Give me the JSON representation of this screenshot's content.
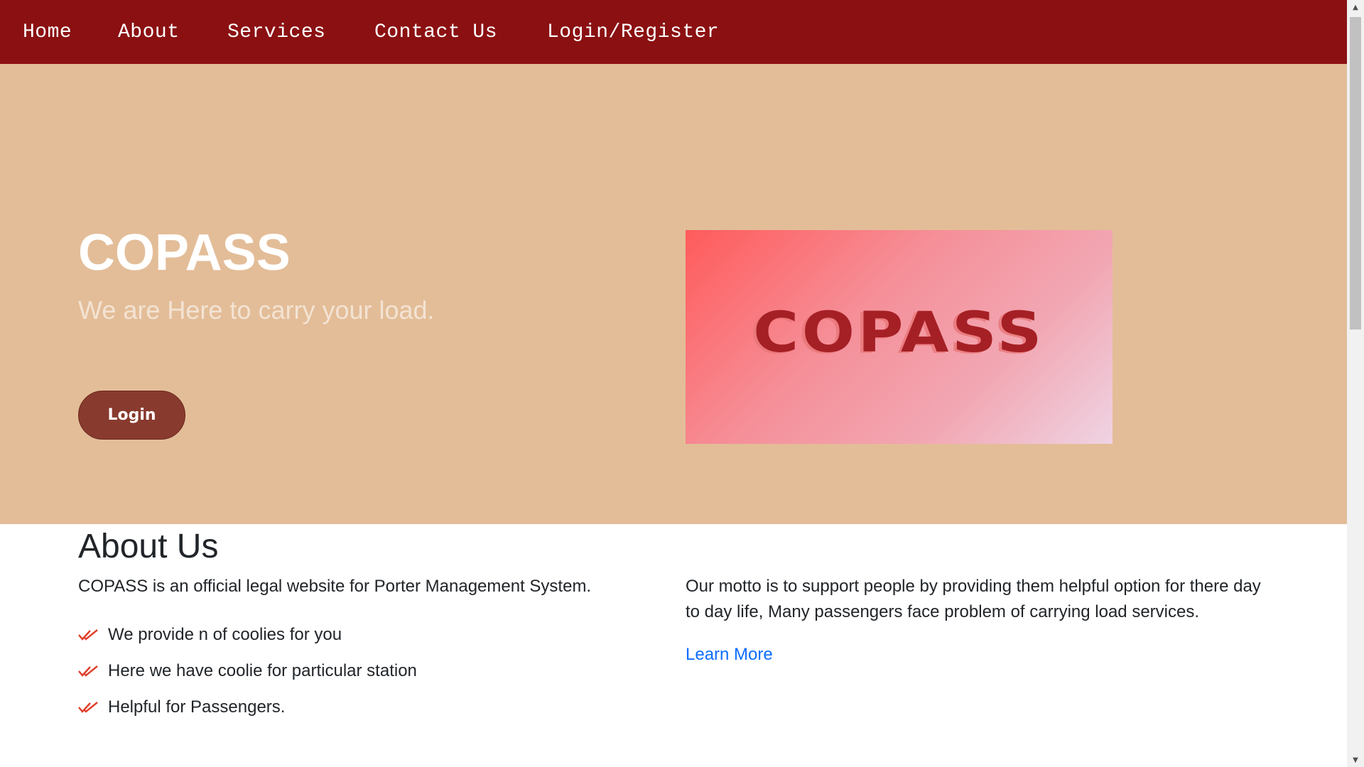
{
  "nav": {
    "items": [
      {
        "label": "Home"
      },
      {
        "label": "About"
      },
      {
        "label": "Services"
      },
      {
        "label": "Contact Us"
      },
      {
        "label": "Login/Register"
      }
    ]
  },
  "hero": {
    "title": "COPASS",
    "subtitle": "We are Here to carry your load.",
    "login_label": "Login",
    "logo_text": "COPASS"
  },
  "about": {
    "heading": "About Us",
    "intro": "COPASS is an official legal website for Porter Management System.",
    "points": [
      "We provide n of coolies for you",
      "Here we have coolie for particular station",
      "Helpful for Passengers."
    ],
    "motto": "Our motto is to support people by providing them helpful option for there day to day life, Many passengers face problem of carrying load services.",
    "learn_more": "Learn More"
  },
  "colors": {
    "navbar": "#8b1012",
    "hero_bg": "#e3bd98",
    "button": "#883a2e",
    "check": "#e0402a",
    "link": "#0d6efd"
  },
  "icons": {
    "list_bullet": "double-check-icon",
    "scroll_up": "scroll-up-arrow-icon",
    "scroll_down": "scroll-down-arrow-icon"
  }
}
